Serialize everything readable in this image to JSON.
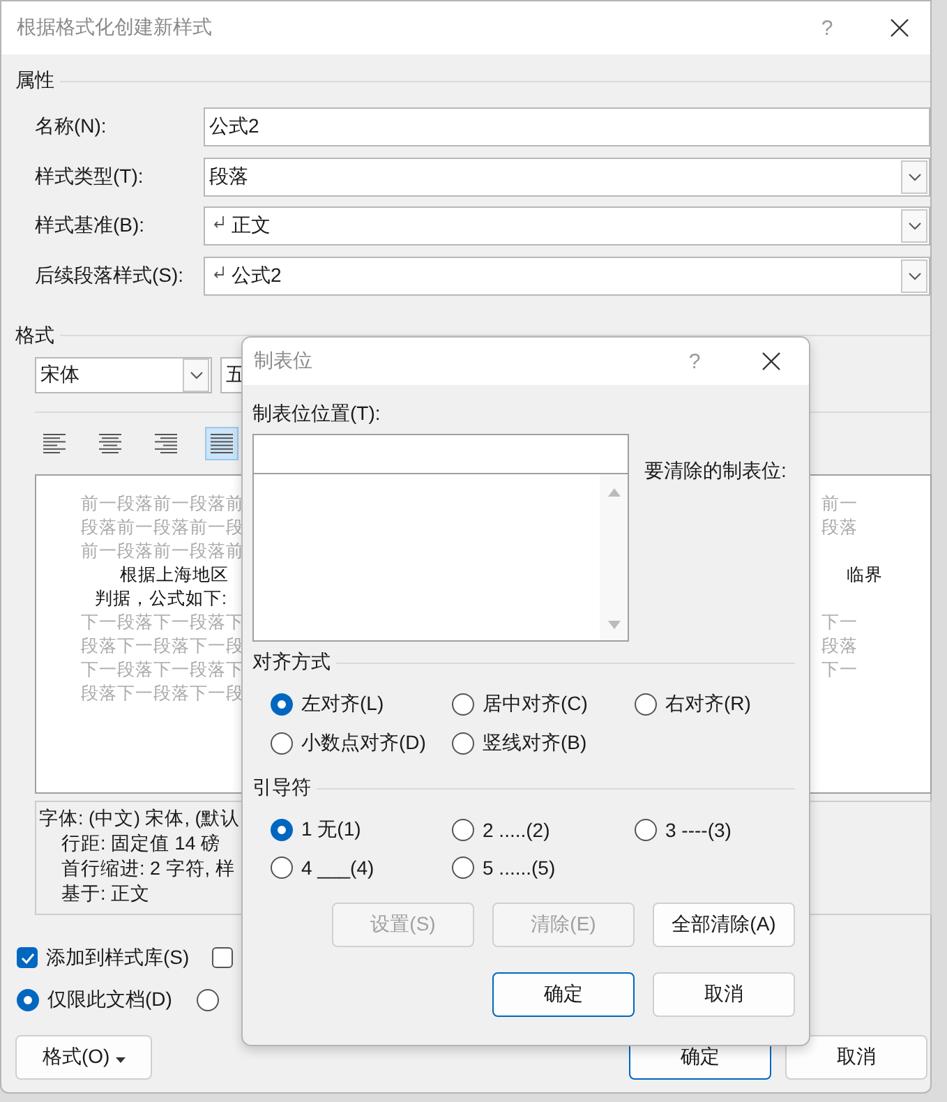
{
  "window": {
    "title": "根据格式化创建新样式",
    "help": "?"
  },
  "properties": {
    "heading": "属性",
    "rows": [
      {
        "label": "名称(N):",
        "value": "公式2",
        "kind": "text",
        "paragraph_icon": false
      },
      {
        "label": "样式类型(T):",
        "value": "段落",
        "kind": "select",
        "paragraph_icon": false
      },
      {
        "label": "样式基准(B):",
        "value": "正文",
        "kind": "select",
        "paragraph_icon": true
      },
      {
        "label": "后续段落样式(S):",
        "value": "公式2",
        "kind": "select",
        "paragraph_icon": true
      }
    ]
  },
  "format": {
    "heading": "格式",
    "font": "宋体",
    "size": "五",
    "align_buttons": [
      {
        "kind": "left",
        "selected": false
      },
      {
        "kind": "center",
        "selected": false
      },
      {
        "kind": "right",
        "selected": false
      },
      {
        "kind": "justify",
        "selected": true
      }
    ]
  },
  "preview": {
    "left_lines": [
      {
        "text": "前一段落前一段落前",
        "kind": "context"
      },
      {
        "text": "段落前一段落前一段",
        "kind": "context"
      },
      {
        "text": "前一段落前一段落前",
        "kind": "context"
      },
      {
        "text": "根据上海地区",
        "kind": "body_first"
      },
      {
        "text": "判据，公式如下:",
        "kind": "body"
      },
      {
        "text": "下一段落下一段落下",
        "kind": "context"
      },
      {
        "text": "段落下一段落下一段",
        "kind": "context"
      },
      {
        "text": "下一段落下一段落下",
        "kind": "context"
      },
      {
        "text": "段落下一段落下一段",
        "kind": "context"
      }
    ],
    "right_groups": [
      {
        "kind": "context",
        "lines": [
          "前一",
          "段落"
        ]
      },
      {
        "kind": "body",
        "lines": [
          "临界"
        ]
      },
      {
        "kind": "context",
        "lines": [
          "下一",
          "段落",
          "下一"
        ]
      }
    ]
  },
  "description": [
    {
      "text": "字体: (中文) 宋体, (默认",
      "kind": "heading"
    },
    {
      "text": "行距: 固定值 14 磅",
      "kind": "detail"
    },
    {
      "text": "首行缩进:  2 字符, 样",
      "kind": "detail"
    },
    {
      "text": "基于: 正文",
      "kind": "detail"
    }
  ],
  "checkboxes": [
    {
      "label": "添加到样式库(S)",
      "checked": true
    },
    {
      "checked": false
    }
  ],
  "radios": [
    {
      "label": "仅限此文档(D)",
      "selected": true
    },
    {
      "selected": false
    }
  ],
  "buttons": {
    "format": "格式(O)",
    "ok": "确定",
    "cancel": "取消"
  },
  "tab_dialog": {
    "title": "制表位",
    "help": "?",
    "position_label": "制表位位置(T):",
    "clear_label": "要清除的制表位:",
    "alignment": {
      "heading": "对齐方式",
      "options": [
        {
          "label": "左对齐(L)",
          "selected": true
        },
        {
          "label": "居中对齐(C)",
          "selected": false
        },
        {
          "label": "右对齐(R)",
          "selected": false
        },
        {
          "label": "小数点对齐(D)",
          "selected": false
        },
        {
          "label": "竖线对齐(B)",
          "selected": false
        }
      ]
    },
    "leader": {
      "heading": "引导符",
      "options": [
        {
          "label": "1 无(1)",
          "selected": true
        },
        {
          "label": "2 .....(2)",
          "selected": false
        },
        {
          "label": "3 ----(3)",
          "selected": false
        },
        {
          "label": "4 ___(4)",
          "selected": false
        },
        {
          "label": "5 ......(5)",
          "selected": false
        }
      ]
    },
    "action_buttons": [
      {
        "label": "设置(S)",
        "disabled": true
      },
      {
        "label": "清除(E)",
        "disabled": true
      },
      {
        "label": "全部清除(A)",
        "disabled": false
      }
    ],
    "ok": "确定",
    "cancel": "取消"
  }
}
